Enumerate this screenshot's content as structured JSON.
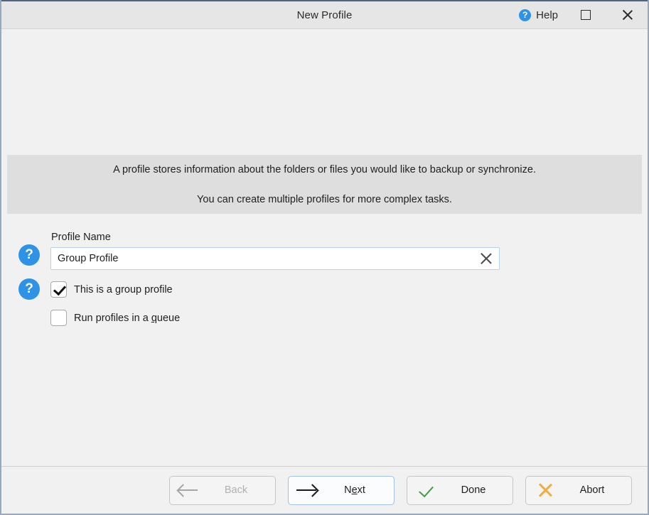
{
  "window": {
    "title": "New Profile"
  },
  "titlebar": {
    "help_label": "Help",
    "help_icon": "question-circle-icon",
    "maximize_icon": "maximize-icon",
    "close_icon": "close-icon"
  },
  "banner": {
    "line1": "A profile stores information about the folders or files you would like to backup or synchronize.",
    "line2": "You can create multiple profiles for more complex tasks."
  },
  "form": {
    "help_icon": "question-circle-icon",
    "profile_name": {
      "label": "Profile Name",
      "value": "Group Profile",
      "placeholder": "",
      "clear_icon": "clear-x-icon"
    },
    "checkboxes": [
      {
        "label": "This is a group profile",
        "checked": true,
        "accel_before": "This is a group profile",
        "accel_char": "",
        "accel_after": ""
      },
      {
        "label": "Run profiles in a queue",
        "checked": false,
        "accel_before": "Run profiles in a ",
        "accel_char": "q",
        "accel_after": "ueue"
      }
    ]
  },
  "footer": {
    "buttons": [
      {
        "label": "Back",
        "icon": "arrow-left-icon",
        "state": "disabled",
        "accel_before": "Back",
        "accel_char": "",
        "accel_after": ""
      },
      {
        "label": "Next",
        "icon": "arrow-right-icon",
        "state": "focused",
        "accel_before": "N",
        "accel_char": "e",
        "accel_after": "xt"
      },
      {
        "label": "Done",
        "icon": "check-icon",
        "state": "normal",
        "accel_before": "Done",
        "accel_char": "",
        "accel_after": ""
      },
      {
        "label": "Abort",
        "icon": "x-icon",
        "state": "normal",
        "accel_before": "Abort",
        "accel_char": "",
        "accel_after": ""
      }
    ]
  },
  "colors": {
    "accent_blue": "#2e93e6",
    "window_border": "#4e6487",
    "banner_bg": "#dedede",
    "page_bg": "#f1f1f1",
    "titlebar_bg": "#e6e6e6",
    "done_green": "#3f9f46",
    "abort_orange": "#f0ab42",
    "focus_border": "#9dc4e8"
  }
}
